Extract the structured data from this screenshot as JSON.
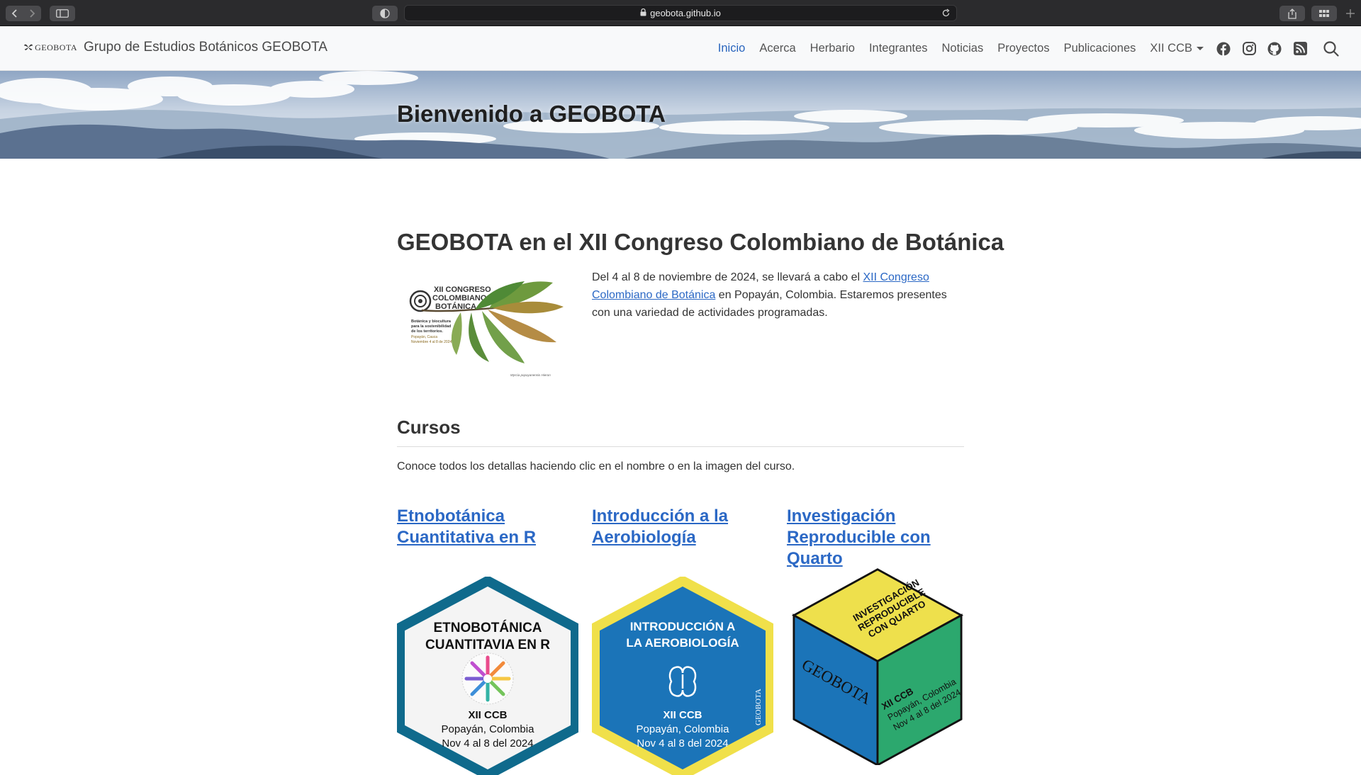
{
  "browser": {
    "url": "geobota.github.io"
  },
  "navbar": {
    "logo_text": "GEOBOTA",
    "brand_title": "Grupo de Estudios Botánicos GEOBOTA",
    "links": [
      "Inicio",
      "Acerca",
      "Herbario",
      "Integrantes",
      "Noticias",
      "Proyectos",
      "Publicaciones",
      "XII CCB"
    ],
    "active": "Inicio",
    "social_icons": [
      "facebook-icon",
      "instagram-icon",
      "github-icon",
      "rss-icon"
    ]
  },
  "banner": {
    "title": "Bienvenido a GEOBOTA"
  },
  "congress": {
    "heading": "GEOBOTA en el XII Congreso Colombiano de Botánica",
    "text_before": "Del 4 al 8 de noviembre de 2024, se llevará a cabo el ",
    "link_text": "XII Congreso Colombiano de Botánica",
    "text_after": " en Popayán, Colombia. Estaremos presentes con una variedad de actividades programadas.",
    "poster": {
      "line1": "XII CONGRESO",
      "line2": "COLOMBIANO DE",
      "line3": "BOTÁNICA",
      "sub1": "Botánica y biocultura",
      "sub2": "para la sostenibilidad",
      "sub3": "de los territorios.",
      "place": "Popayán, Cauca",
      "dates": "Noviembre 4 al 8 de 2024",
      "species": "Myrcia popayanensis Hieron"
    }
  },
  "cursos": {
    "heading": "Cursos",
    "intro": "Conoce todos los detallas haciendo clic en el nombre o en la imagen del curso.",
    "items": [
      {
        "title": "Etnobotánica Cuantitativa en R",
        "badge_l1": "ETNOBOTÁNICA",
        "badge_l2": "CUANTITAVIA EN R",
        "event": "XII CCB",
        "place": "Popayán, Colombia",
        "dates": "Nov 4 al 8 del 2024",
        "color": "#0f6a8c"
      },
      {
        "title": "Introducción a la Aerobiología",
        "badge_l1": "INTRODUCCIÓN A",
        "badge_l2": "LA AEROBIOLOGÍA",
        "event": "XII CCB",
        "place": "Popayán, Colombia",
        "dates": "Nov 4 al 8 del 2024",
        "side": "GEOBOTA",
        "color": "#1b74b8"
      },
      {
        "title": "Investigación Reproducible con Quarto",
        "top_l1": "INVESTIGACIÓN",
        "top_l2": "REPRODUCIBLE",
        "top_l3": "CON QUARTO",
        "left": "GEOBOTA",
        "right_l1": "XII CCB",
        "right_l2": "Popayán, Colombia",
        "right_l3": "Nov 4 al 8 del 2024",
        "color": "#2ca86e"
      }
    ]
  }
}
